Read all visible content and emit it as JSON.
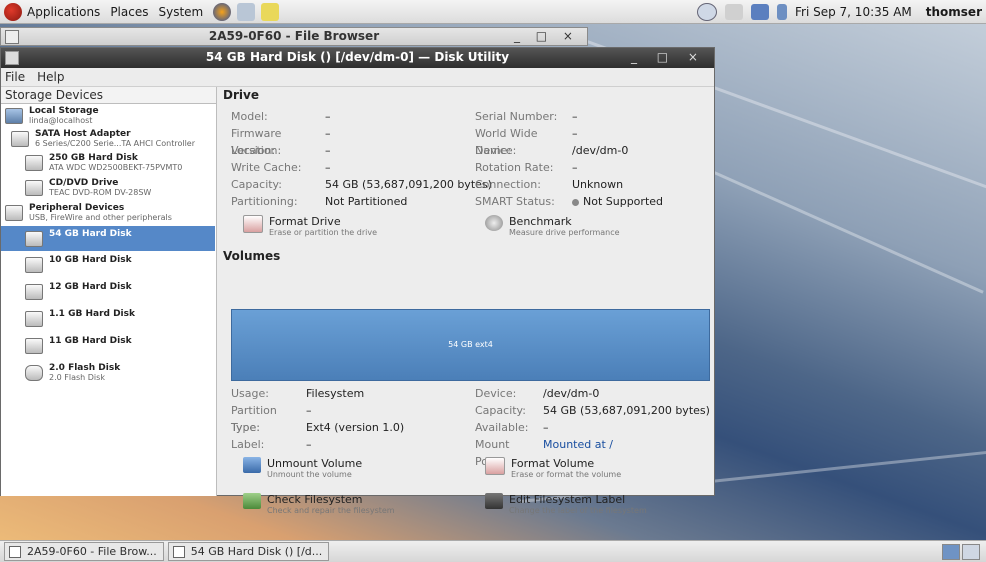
{
  "top_panel": {
    "menus": [
      "Applications",
      "Places",
      "System"
    ],
    "clock": "Fri Sep 7, 10:35 AM",
    "user": "thomser"
  },
  "file_browser": {
    "title": "2A59-0F60 - File Browser",
    "controls": "_ □ ×"
  },
  "disk_utility": {
    "title": "54 GB Hard Disk () [/dev/dm-0] — Disk Utility",
    "controls": "_ □ ×",
    "menu": {
      "file": "File",
      "help": "Help"
    }
  },
  "sidebar": {
    "header": "Storage Devices",
    "items": [
      {
        "title": "Local Storage",
        "sub": "linda@localhost"
      },
      {
        "title": "SATA Host Adapter",
        "sub": "6 Series/C200 Serie...TA AHCI Controller"
      },
      {
        "title": "250 GB Hard Disk",
        "sub": "ATA WDC WD2500BEKT-75PVMT0"
      },
      {
        "title": "CD/DVD Drive",
        "sub": "TEAC DVD-ROM DV-28SW"
      },
      {
        "title": "Peripheral Devices",
        "sub": "USB, FireWire and other peripherals"
      },
      {
        "title": "54 GB Hard Disk",
        "sub": ""
      },
      {
        "title": "10 GB Hard Disk",
        "sub": ""
      },
      {
        "title": "12 GB Hard Disk",
        "sub": ""
      },
      {
        "title": "1.1 GB Hard Disk",
        "sub": ""
      },
      {
        "title": "11 GB Hard Disk",
        "sub": ""
      },
      {
        "title": "2.0 Flash Disk",
        "sub": "2.0 Flash Disk"
      }
    ]
  },
  "drive": {
    "section_title": "Drive",
    "left": [
      {
        "k": "Model:",
        "v": "–"
      },
      {
        "k": "Firmware Version:",
        "v": "–"
      },
      {
        "k": "Location:",
        "v": "–"
      },
      {
        "k": "Write Cache:",
        "v": "–"
      },
      {
        "k": "Capacity:",
        "v": "54 GB (53,687,091,200 bytes)"
      },
      {
        "k": "Partitioning:",
        "v": "Not Partitioned"
      }
    ],
    "right": [
      {
        "k": "Serial Number:",
        "v": "–"
      },
      {
        "k": "World Wide Name:",
        "v": "–"
      },
      {
        "k": "Device:",
        "v": "/dev/dm-0"
      },
      {
        "k": "Rotation Rate:",
        "v": "–"
      },
      {
        "k": "Connection:",
        "v": "Unknown"
      },
      {
        "k": "SMART Status:",
        "v": "Not Supported"
      }
    ],
    "actions": [
      {
        "label": "Format Drive",
        "desc": "Erase or partition the drive"
      },
      {
        "label": "Benchmark",
        "desc": "Measure drive performance"
      }
    ]
  },
  "volumes": {
    "section_title": "Volumes",
    "bar_label": "54 GB ext4",
    "left": [
      {
        "k": "Usage:",
        "v": "Filesystem"
      },
      {
        "k": "Partition Type:",
        "v": "–"
      },
      {
        "k": "Type:",
        "v": "Ext4 (version 1.0)"
      },
      {
        "k": "Label:",
        "v": "–"
      }
    ],
    "right": [
      {
        "k": "Device:",
        "v": "/dev/dm-0"
      },
      {
        "k": "Capacity:",
        "v": "54 GB (53,687,091,200 bytes)"
      },
      {
        "k": "Available:",
        "v": "–"
      },
      {
        "k": "Mount Point:",
        "v": "Mounted at /"
      }
    ],
    "actions": [
      {
        "label": "Unmount Volume",
        "desc": "Unmount the volume"
      },
      {
        "label": "Format Volume",
        "desc": "Erase or format the volume"
      },
      {
        "label": "Check Filesystem",
        "desc": "Check and repair the filesystem"
      },
      {
        "label": "Edit Filesystem Label",
        "desc": "Change the label of the filesystem"
      }
    ]
  },
  "taskbar": {
    "tasks": [
      "2A59-0F60 - File Brow...",
      "54 GB Hard Disk () [/d..."
    ]
  }
}
